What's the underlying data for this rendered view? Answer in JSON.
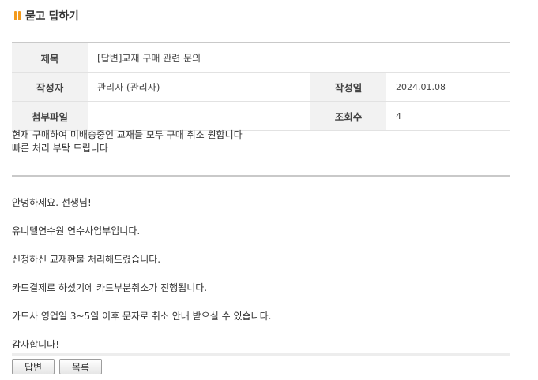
{
  "header": {
    "title": "묻고 답하기"
  },
  "post": {
    "labels": {
      "subject": "제목",
      "author": "작성자",
      "date": "작성일",
      "attachment": "첨부파일",
      "views": "조회수"
    },
    "subject": "[답변]교재 구매 관련 문의",
    "author": "관리자 (관리자)",
    "date": "2024.01.08",
    "attachment": "",
    "views": "4"
  },
  "question": {
    "lines": [
      "현재 구매하여 미배송중인 교재들 모두 구매 취소 원합니다",
      "빠른 처리 부탁 드립니다"
    ]
  },
  "answer": {
    "paragraphs": [
      "안녕하세요. 선생님!",
      "유니텔연수원 연수사업부입니다.",
      "신청하신 교재환불 처리해드렸습니다.",
      "카드결제로 하셨기에 카드부분취소가 진행됩니다.",
      "카드사 영업일 3~5일 이후 문자로 취소 안내 받으실 수 있습니다.",
      "감사합니다!"
    ]
  },
  "buttons": {
    "reply": "답변",
    "list": "목록"
  },
  "colors": {
    "accent": "#f39a1c",
    "label_bg": "#f2f2f2",
    "border": "#c9c9c9"
  }
}
